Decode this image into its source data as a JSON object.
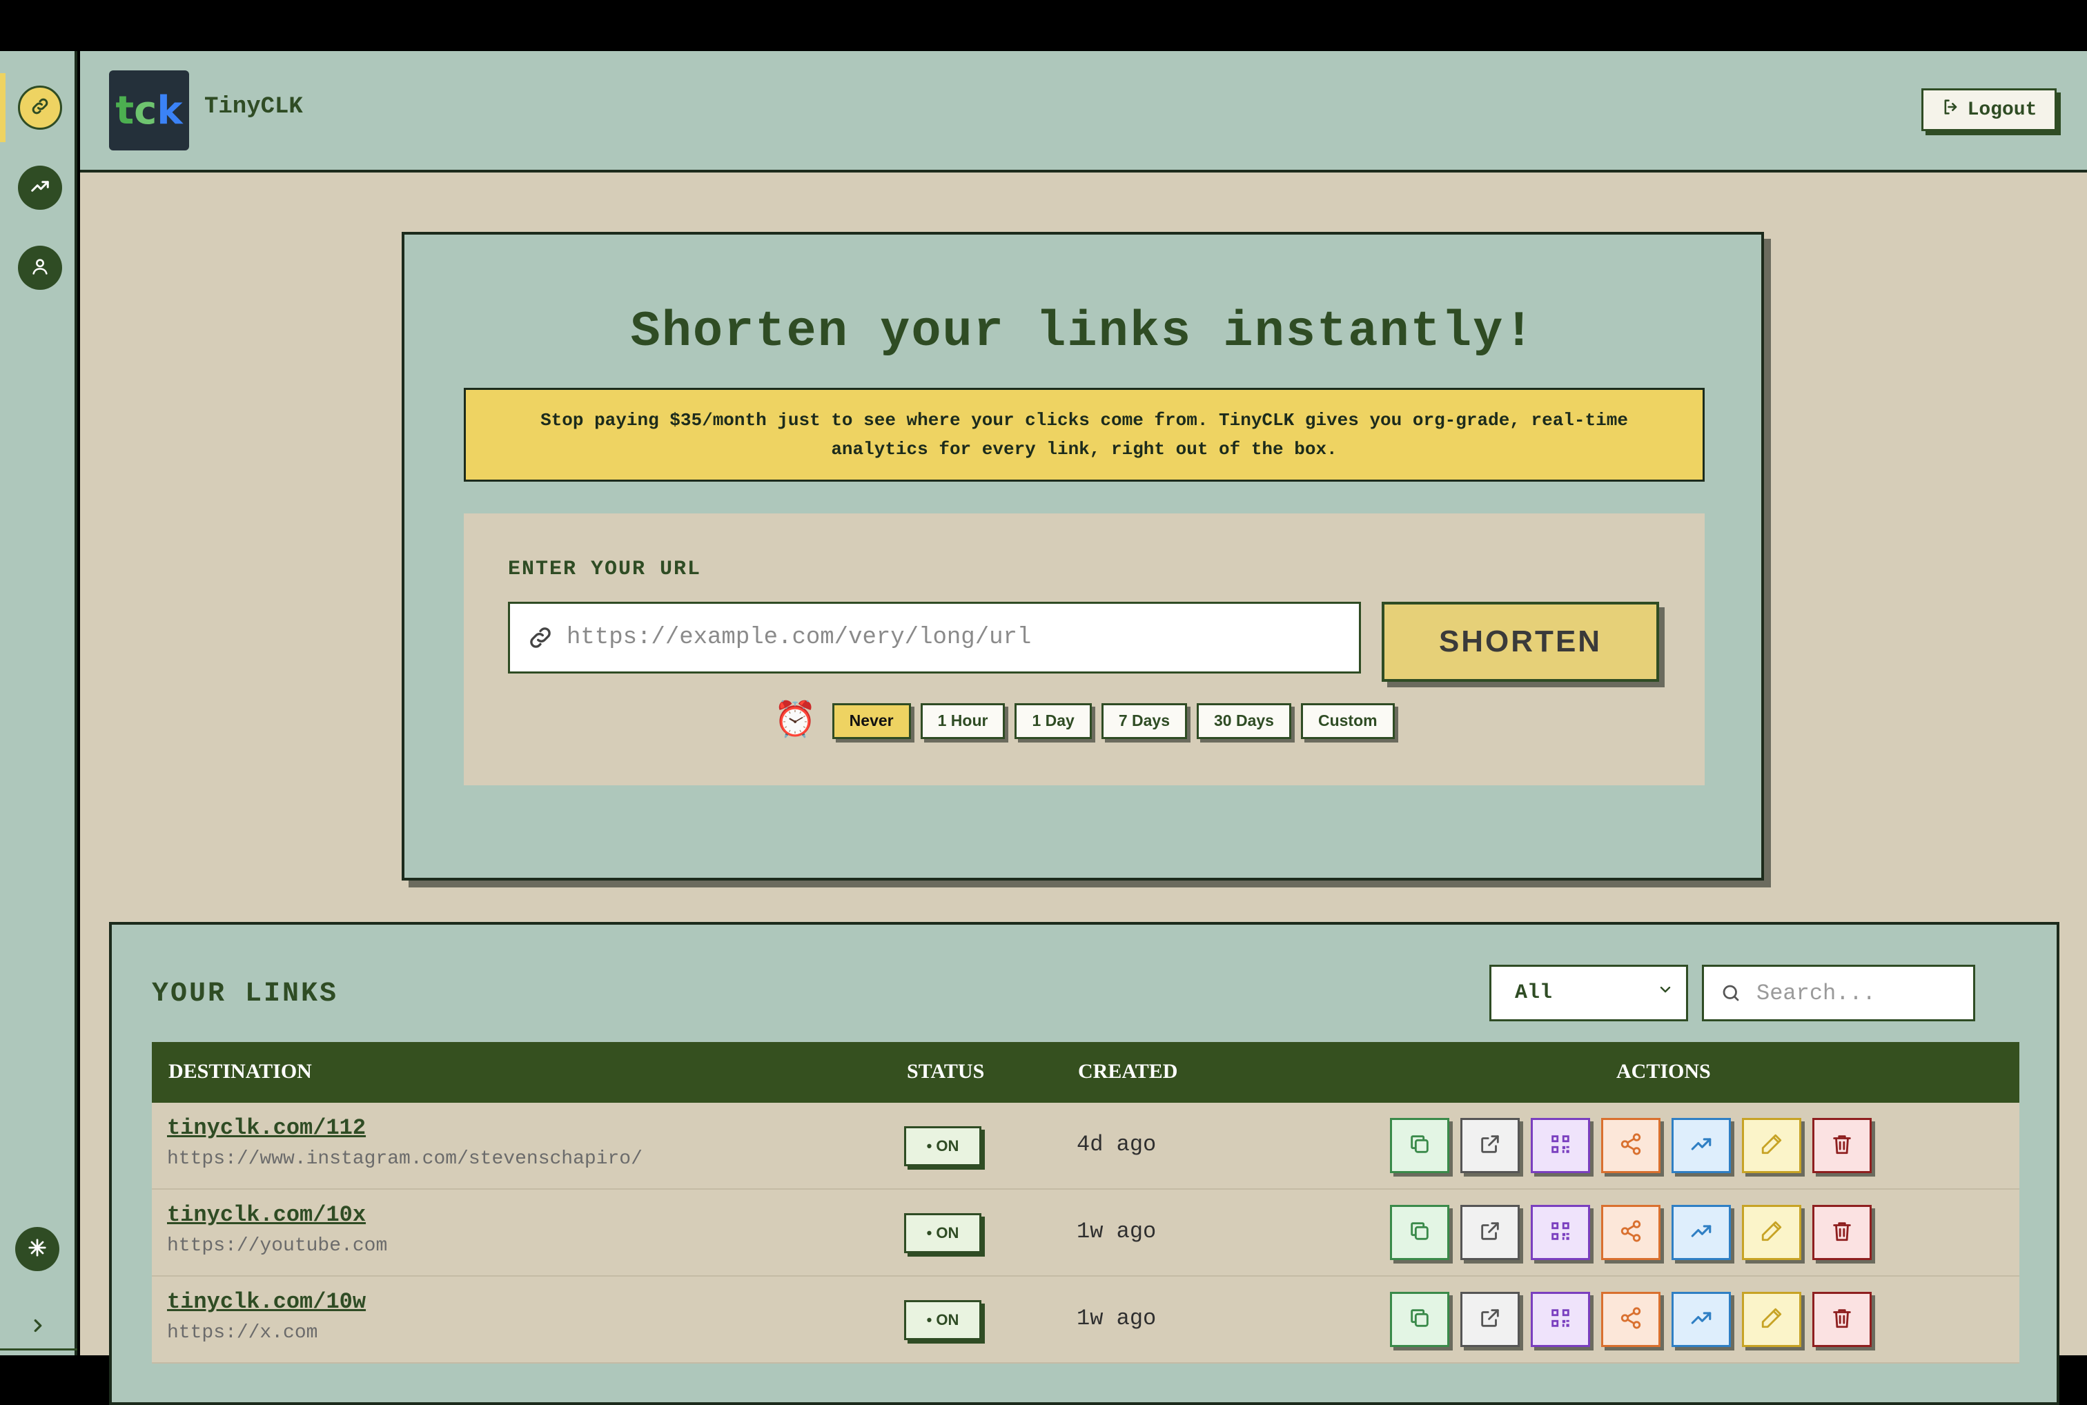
{
  "app": {
    "name": "TinyCLK",
    "logo_text": "tck"
  },
  "header": {
    "logout_label": "Logout"
  },
  "sidebar": {
    "items": [
      {
        "name": "links",
        "icon": "link-icon",
        "active": true
      },
      {
        "name": "analytics",
        "icon": "trend-icon",
        "active": false
      },
      {
        "name": "profile",
        "icon": "user-icon",
        "active": false
      }
    ],
    "bottom_icon": "snowflake-icon",
    "collapse_icon": "chevron-right-icon"
  },
  "hero": {
    "title": "Shorten your links instantly!",
    "promo": "Stop paying $35/month just to see where your clicks come from. TinyCLK gives you org-grade, real-time analytics for every link, right out of the box.",
    "url_label": "ENTER YOUR URL",
    "url_placeholder": "https://example.com/very/long/url",
    "shorten_label": "SHORTEN",
    "expiry_icon": "⏰",
    "expiry_options": [
      "Never",
      "1 Hour",
      "1 Day",
      "7 Days",
      "30 Days",
      "Custom"
    ],
    "expiry_selected": "Never"
  },
  "links": {
    "title": "YOUR LINKS",
    "filter_value": "All",
    "search_placeholder": "Search...",
    "columns": [
      "DESTINATION",
      "STATUS",
      "CREATED",
      "ACTIONS"
    ],
    "rows": [
      {
        "short": "tinyclk.com/112",
        "dest": "https://www.instagram.com/stevenschapiro/",
        "status": "• ON",
        "created": "4d ago"
      },
      {
        "short": "tinyclk.com/10x",
        "dest": "https://youtube.com",
        "status": "• ON",
        "created": "1w ago"
      },
      {
        "short": "tinyclk.com/10w",
        "dest": "https://x.com",
        "status": "• ON",
        "created": "1w ago"
      }
    ]
  },
  "colors": {
    "sage": "#aec7bb",
    "tan": "#d6cdb8",
    "forest": "#2f4c24",
    "yellow": "#eed362",
    "table_header": "#35501f"
  }
}
